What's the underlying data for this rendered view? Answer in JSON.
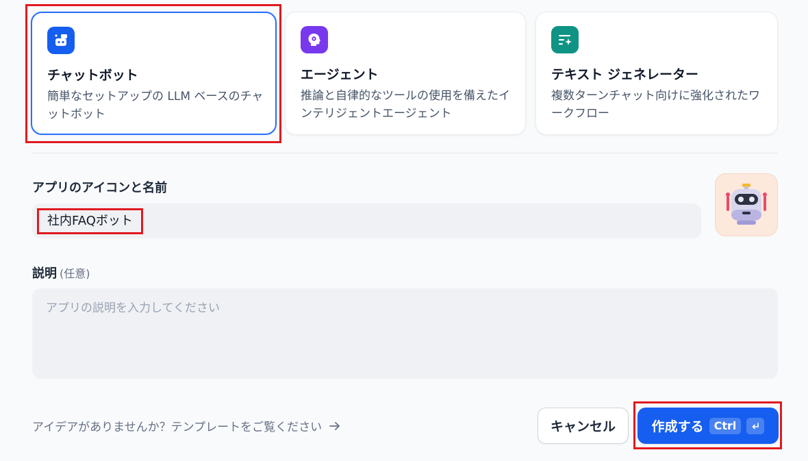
{
  "app_types": [
    {
      "title": "チャットボット",
      "description": "簡単なセットアップの LLM ベースのチャットボット",
      "icon": "chatbot-icon",
      "color": "#155eef",
      "selected": true
    },
    {
      "title": "エージェント",
      "description": "推論と自律的なツールの使用を備えたインテリジェントエージェント",
      "icon": "agent-icon",
      "color": "#7839ee",
      "selected": false
    },
    {
      "title": "テキスト ジェネレーター",
      "description": "複数ターンチャット向けに強化されたワークフロー",
      "icon": "text-generator-icon",
      "color": "#0e9384",
      "selected": false
    }
  ],
  "name_field": {
    "label": "アプリのアイコンと名前",
    "value": "社内FAQボット",
    "avatar_icon": "robot-icon"
  },
  "description_field": {
    "label": "説明",
    "optional_label": "(任意)",
    "placeholder": "アプリの説明を入力してください"
  },
  "footer": {
    "template_hint": "アイデアがありませんか？テンプレートをご覧ください",
    "cancel_label": "キャンセル",
    "create_label": "作成する",
    "shortcut_key": "Ctrl"
  },
  "colors": {
    "accent": "#155eef",
    "selected_border": "#2970ff",
    "annotation_red": "#e0191f"
  }
}
